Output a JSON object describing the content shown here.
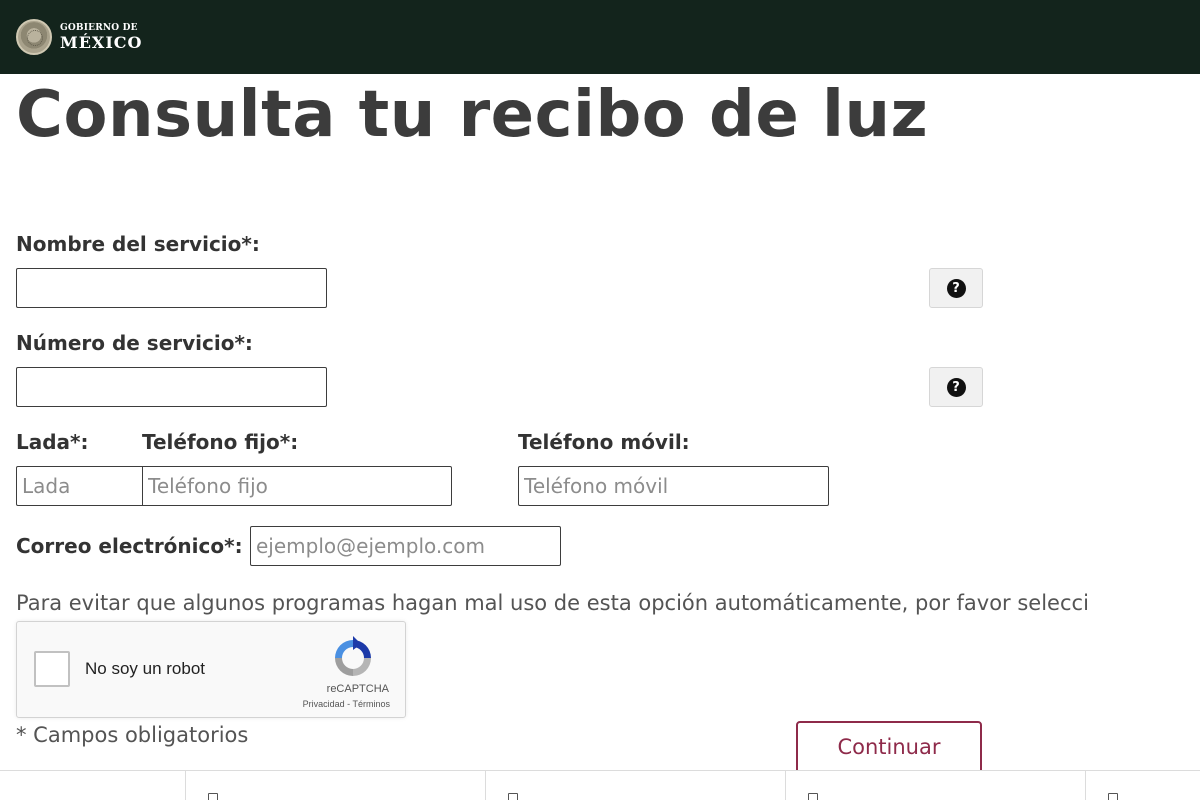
{
  "header": {
    "logo_line1": "GOBIERNO DE",
    "logo_line2": "MÉXICO",
    "logo_icon": "national-seal-icon"
  },
  "page": {
    "title": "Consulta tu recibo de luz"
  },
  "form": {
    "service_name_label": "Nombre del servicio*:",
    "service_name_value": "",
    "service_number_label": "Número de servicio*:",
    "service_number_value": "",
    "help_icon": "question-circle-icon",
    "lada_label": "Lada*:",
    "lada_placeholder": "Lada",
    "phone_label": "Teléfono fijo*:",
    "phone_placeholder": "Teléfono fijo",
    "mobile_label": "Teléfono móvil:",
    "mobile_placeholder": "Teléfono móvil",
    "email_label": "Correo electrónico*:",
    "email_placeholder": "ejemplo@ejemplo.com",
    "notice": "Para evitar que algunos programas hagan mal uso de esta opción automáticamente, por favor selecci",
    "required_note": "* Campos obligatorios",
    "continue_label": "Continuar"
  },
  "recaptcha": {
    "label": "No soy un robot",
    "brand": "reCAPTCHA",
    "links": "Privacidad - Términos",
    "checked": false
  },
  "colors": {
    "header_bg": "#13241c",
    "accent": "#8e2a4a"
  }
}
